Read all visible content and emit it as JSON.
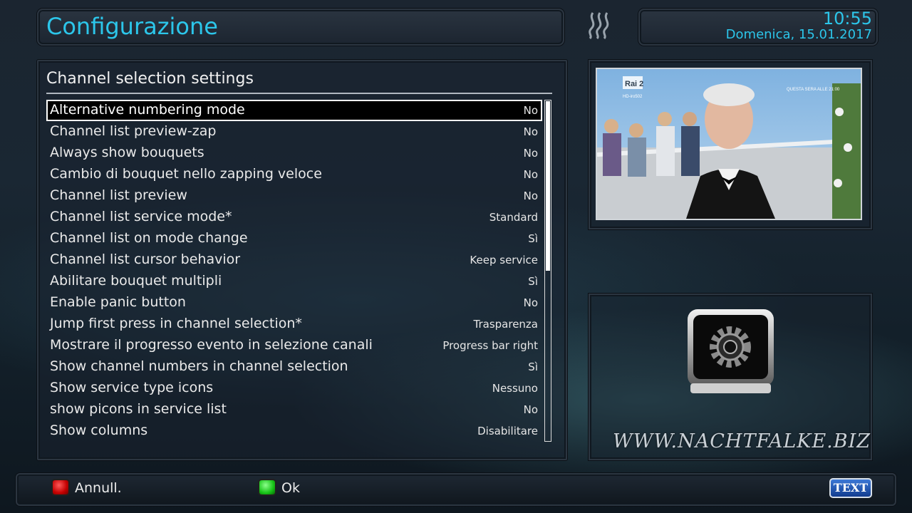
{
  "header": {
    "title": "Configurazione",
    "time": "10:55",
    "date": "Domenica, 15.01.2017"
  },
  "section": {
    "title": "Channel selection settings"
  },
  "settings": [
    {
      "label": "Alternative numbering mode",
      "value": "No",
      "selected": true
    },
    {
      "label": "Channel list preview-zap",
      "value": "No"
    },
    {
      "label": "Always show bouquets",
      "value": "No"
    },
    {
      "label": "Cambio di bouquet nello zapping veloce",
      "value": "No"
    },
    {
      "label": "Channel list preview",
      "value": "No"
    },
    {
      "label": "Channel list service mode*",
      "value": "Standard"
    },
    {
      "label": "Channel list on mode change",
      "value": "Sì"
    },
    {
      "label": "Channel list cursor behavior",
      "value": "Keep service"
    },
    {
      "label": "Abilitare bouquet multipli",
      "value": "Sì"
    },
    {
      "label": "Enable panic button",
      "value": "No"
    },
    {
      "label": "Jump first press in channel selection*",
      "value": "Trasparenza"
    },
    {
      "label": "Mostrare il progresso evento in selezione canali",
      "value": "Progress bar right"
    },
    {
      "label": "Show channel numbers in channel selection",
      "value": "Sì"
    },
    {
      "label": "Show service type icons",
      "value": "Nessuno"
    },
    {
      "label": "show picons in service list",
      "value": "No"
    },
    {
      "label": "Show columns",
      "value": "Disabilitare"
    }
  ],
  "scroll": {
    "position_fraction": 0.5
  },
  "preview": {
    "channel_logo": "Rai 2",
    "channel_sub": "HD-iro502",
    "overlay": "QUESTA SERA ALLE 21:00"
  },
  "watermark": "WWW.NACHTFALKE.BIZ",
  "footer": {
    "red_label": "Annull.",
    "green_label": "Ok",
    "text_button": "TEXT"
  },
  "colors": {
    "accent": "#2cc6ea",
    "red_key": "#d40000",
    "green_key": "#1ec21e",
    "text_button": "#1f57b8"
  },
  "icons": {
    "settings": "gear-icon",
    "logo": "wave-logo-icon"
  }
}
